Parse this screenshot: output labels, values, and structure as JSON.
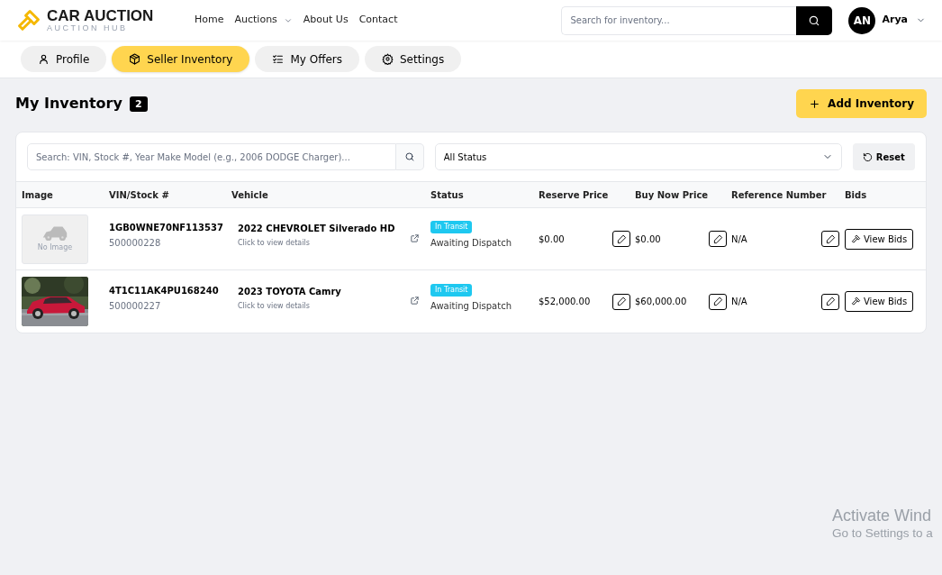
{
  "header": {
    "logo": {
      "title": "CAR AUCTION",
      "subtitle": "AUCTION HUB"
    },
    "nav": [
      {
        "label": "Home",
        "dropdown": false
      },
      {
        "label": "Auctions",
        "dropdown": true
      },
      {
        "label": "About Us",
        "dropdown": false
      },
      {
        "label": "Contact",
        "dropdown": false
      }
    ],
    "search": {
      "placeholder": "Search for inventory..."
    },
    "user": {
      "initials": "AN",
      "name": "Arya"
    }
  },
  "tabs": [
    {
      "label": "Profile",
      "selected": false
    },
    {
      "label": "Seller Inventory",
      "selected": true
    },
    {
      "label": "My Offers",
      "selected": false
    },
    {
      "label": "Settings",
      "selected": false
    }
  ],
  "page": {
    "title": "My Inventory",
    "count": "2",
    "add_button": "Add Inventory"
  },
  "filters": {
    "search_placeholder": "Search: VIN, Stock #, Year Make Model (e.g., 2006 DODGE Charger)...",
    "status": "All Status",
    "reset": "Reset"
  },
  "table": {
    "columns": [
      "Image",
      "VIN/Stock #",
      "Vehicle",
      "Status",
      "Reserve Price",
      "Buy Now Price",
      "Reference Number",
      "Bids"
    ],
    "rows": [
      {
        "image": {
          "kind": "placeholder",
          "text": "No Image"
        },
        "vin": "1GB0WNE70NF113537",
        "stock": "500000228",
        "vehicle": "2022 CHEVROLET Silverado HD",
        "vehicle_hint": "Click to view details",
        "badge": "In Transit",
        "status": "Awaiting Dispatch",
        "reserve_price": "$0.00",
        "buy_now_price": "$0.00",
        "reference_number": "N/A",
        "bids_button": "View Bids"
      },
      {
        "vin": "4T1C11AK4PU168240",
        "stock": "500000227",
        "vehicle": "2023 TOYOTA Camry",
        "vehicle_hint": "Click to view details",
        "badge": "In Transit",
        "status": "Awaiting Dispatch",
        "reserve_price": "$52,000.00",
        "buy_now_price": "$60,000.00",
        "reference_number": "N/A",
        "bids_button": "View Bids"
      }
    ]
  },
  "os_watermark": {
    "title": "Activate Wind",
    "subtitle": "Go to Settings to a"
  }
}
